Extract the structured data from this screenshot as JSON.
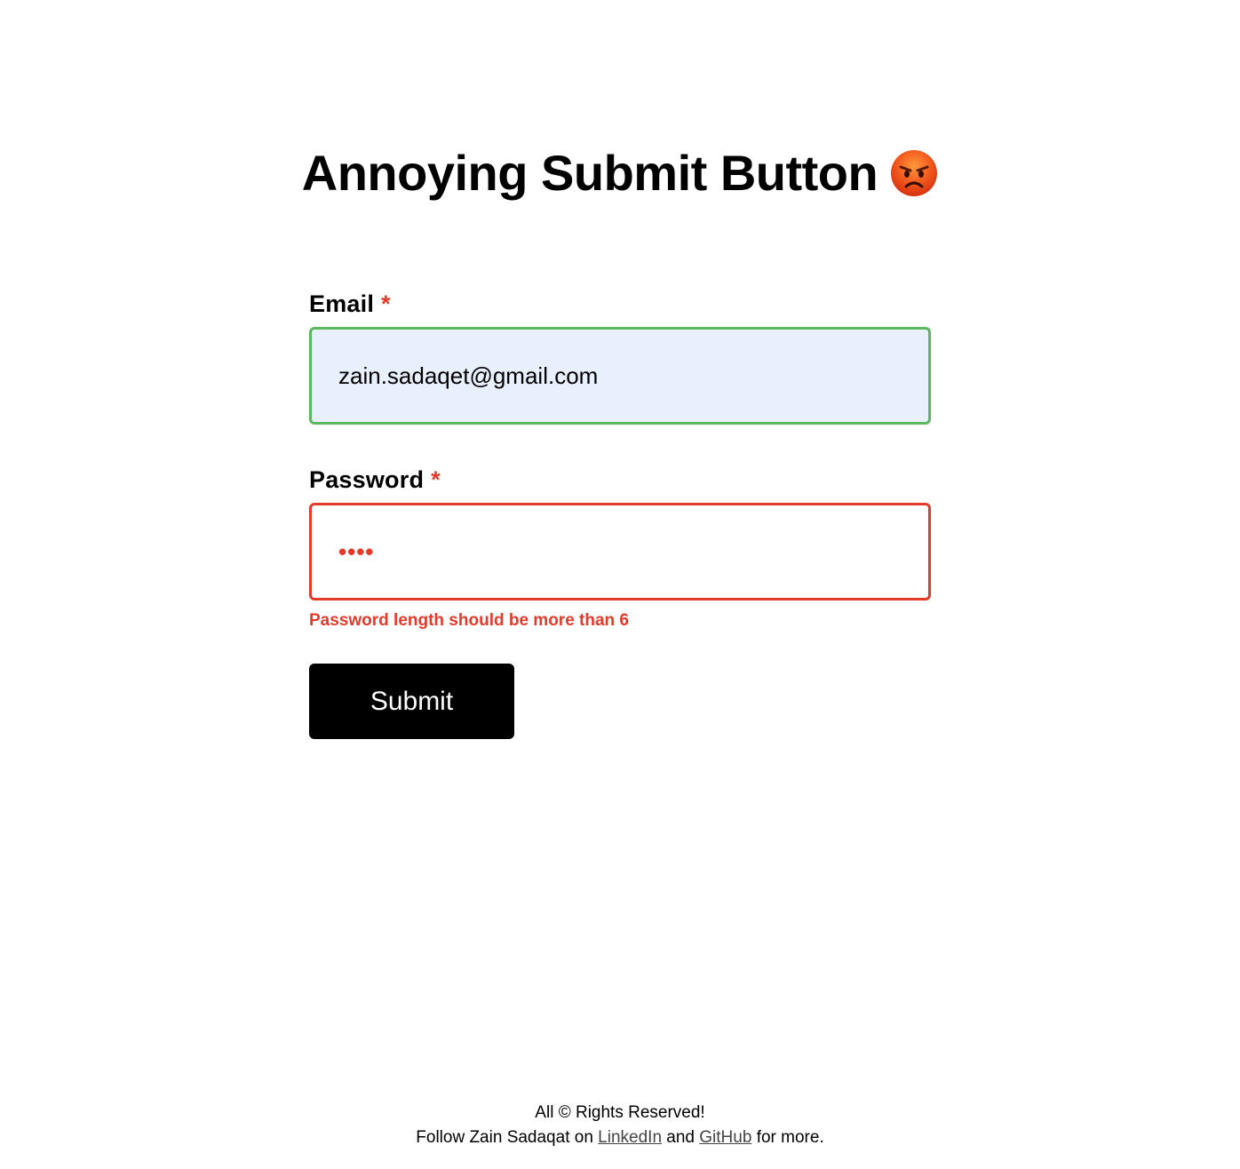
{
  "page": {
    "title": "Annoying Submit Button",
    "title_icon": "angry-face-icon"
  },
  "form": {
    "email": {
      "label": "Email",
      "required_marker": "*",
      "value": "zain.sadaqet@gmail.com",
      "border_color": "#5cb85c",
      "background": "#e8f0fd"
    },
    "password": {
      "label": "Password",
      "required_marker": "*",
      "masked_value": "••••",
      "border_color": "#e53a2a",
      "error": "Password length should be more than 6"
    },
    "submit_label": "Submit"
  },
  "footer": {
    "rights": "All © Rights Reserved!",
    "follow_prefix": "Follow Zain Sadaqat on ",
    "linkedin_label": "LinkedIn",
    "and_text": " and ",
    "github_label": "GitHub",
    "suffix": " for more."
  },
  "colors": {
    "error": "#e53a2a",
    "success": "#5cb85c",
    "button_bg": "#000000"
  }
}
